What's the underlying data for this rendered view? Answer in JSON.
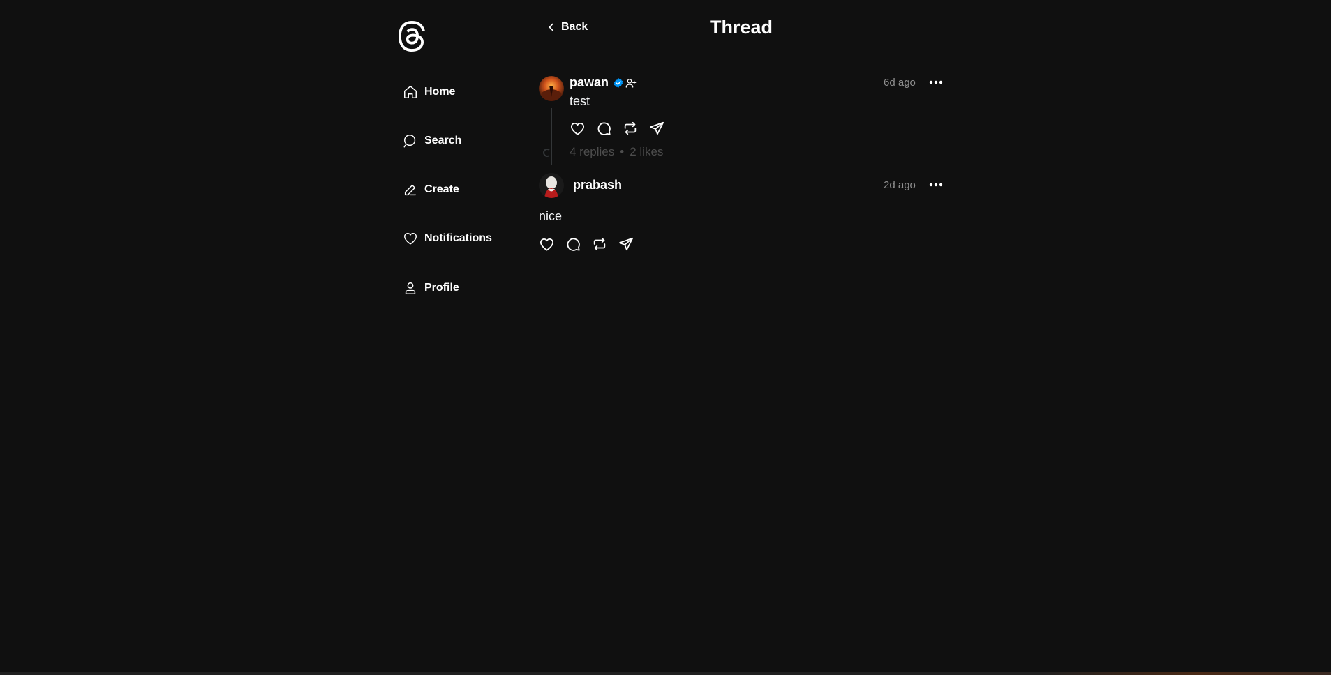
{
  "sidebar": {
    "logo_icon": "threads-logo-icon",
    "items": [
      {
        "label": "Home",
        "icon": "home-icon"
      },
      {
        "label": "Search",
        "icon": "search-icon"
      },
      {
        "label": "Create",
        "icon": "pencil-icon"
      },
      {
        "label": "Notifications",
        "icon": "heart-icon"
      },
      {
        "label": "Profile",
        "icon": "user-icon"
      }
    ]
  },
  "header": {
    "back_label": "Back",
    "title": "Thread"
  },
  "thread": {
    "main_post": {
      "username": "pawan",
      "verified": true,
      "timestamp": "6d ago",
      "text": "test",
      "replies": "4 replies",
      "separator": "•",
      "likes": "2 likes"
    },
    "reply": {
      "username": "prabash",
      "timestamp": "2d ago",
      "text": "nice"
    }
  },
  "colors": {
    "background": "#101010",
    "text": "#ffffff",
    "muted": "#8f8f8f",
    "verified": "#0095f6"
  }
}
